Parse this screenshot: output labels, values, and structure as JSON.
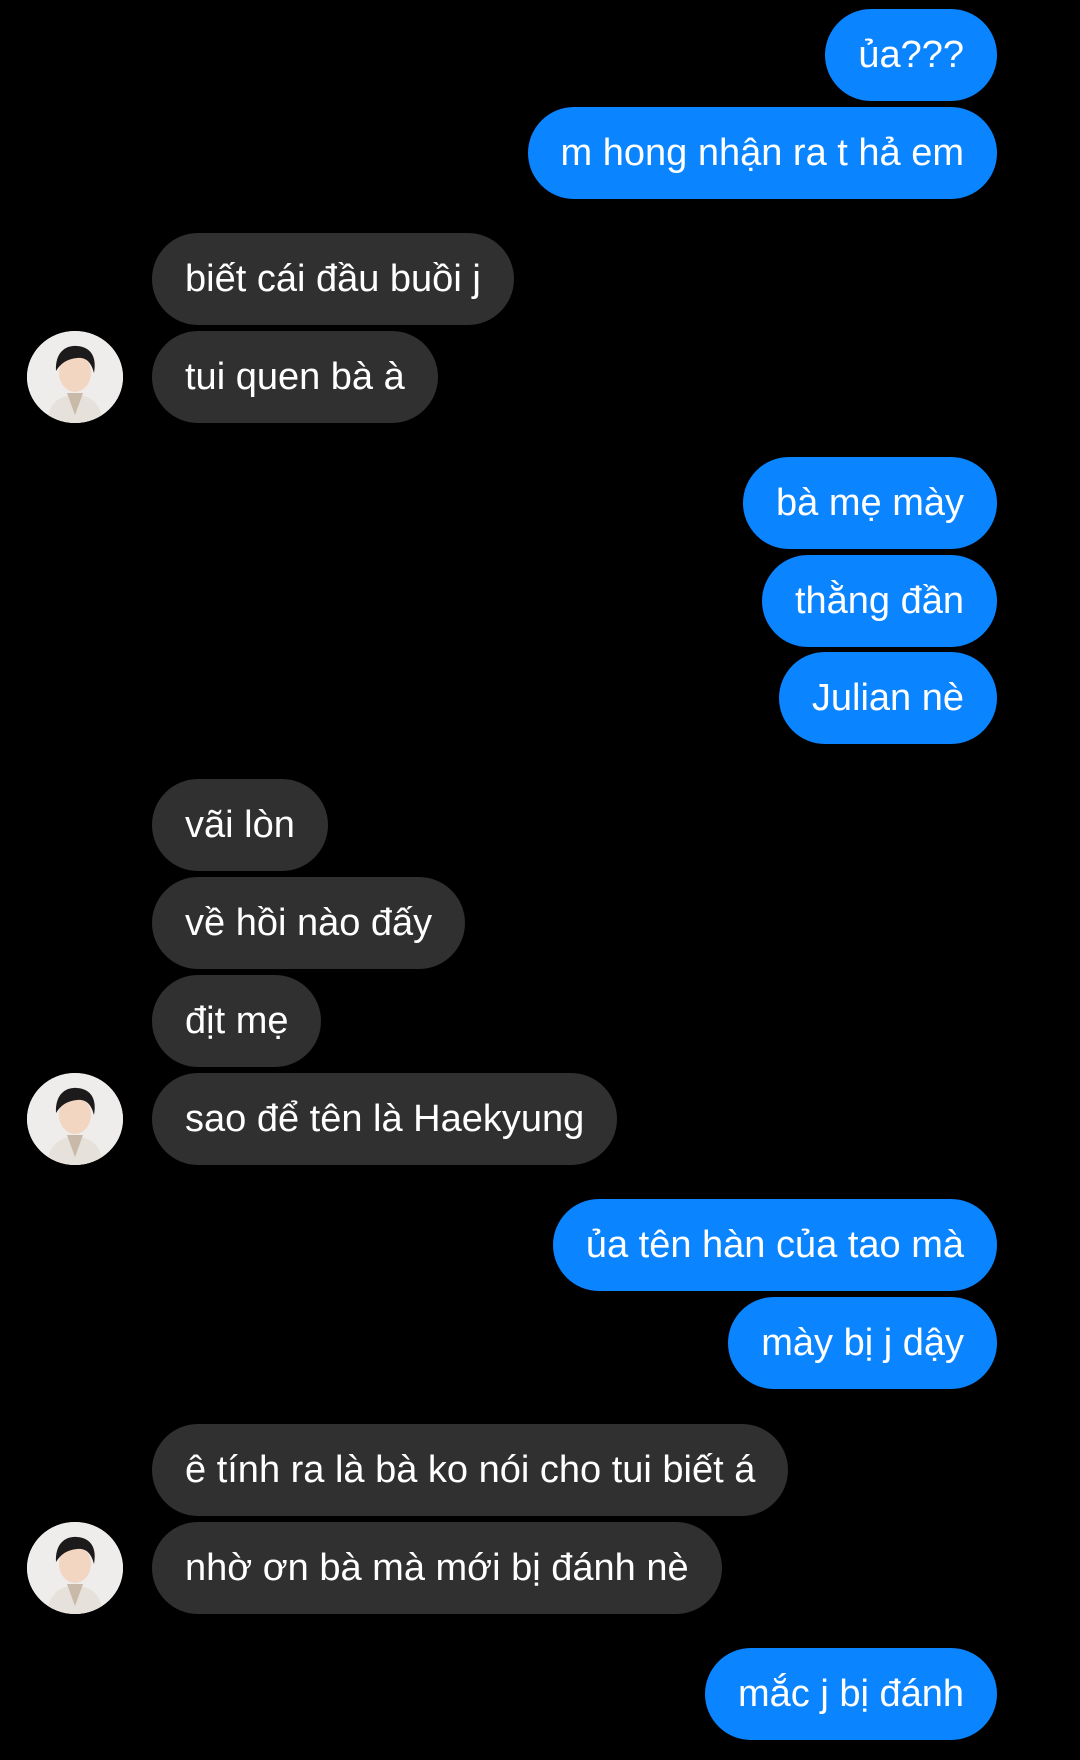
{
  "messages": [
    {
      "side": "sent",
      "text": "ủa???"
    },
    {
      "side": "sent",
      "text": "m hong nhận ra t hả em"
    },
    {
      "side": "recv",
      "text": "biết cái đầu buồi j"
    },
    {
      "side": "recv",
      "text": "tui quen bà à"
    },
    {
      "side": "sent",
      "text": "bà mẹ mày"
    },
    {
      "side": "sent",
      "text": "thằng đần"
    },
    {
      "side": "sent",
      "text": "Julian nè"
    },
    {
      "side": "recv",
      "text": "vãi lòn"
    },
    {
      "side": "recv",
      "text": "về hồi nào đấy"
    },
    {
      "side": "recv",
      "text": "địt mẹ"
    },
    {
      "side": "recv",
      "text": "sao để tên là Haekyung"
    },
    {
      "side": "sent",
      "text": "ủa tên hàn của tao mà"
    },
    {
      "side": "sent",
      "text": "mày bị j dậy"
    },
    {
      "side": "recv",
      "text": "ê tính ra là bà ko nói cho tui biết á"
    },
    {
      "side": "recv",
      "text": "nhờ ơn bà mà mới bị đánh nè"
    },
    {
      "side": "sent",
      "text": "mắc j bị đánh"
    }
  ],
  "colors": {
    "sent_bubble": "#0a84ff",
    "received_bubble": "#303030",
    "background": "#000000",
    "text": "#ffffff"
  },
  "icons": {
    "avatar": "contact-avatar-icon"
  }
}
